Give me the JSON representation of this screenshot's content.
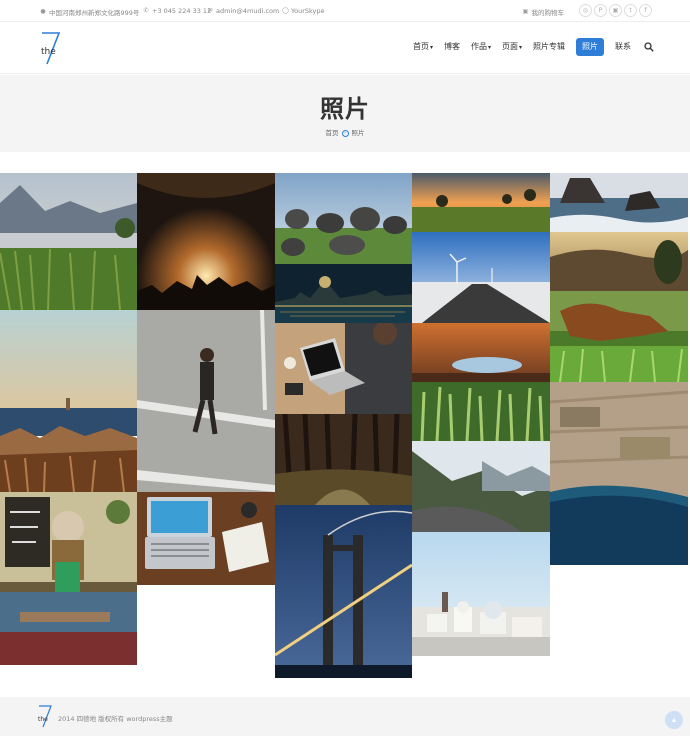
{
  "topbar": {
    "address": "中国河南郑州新郑文化路999号",
    "phone": "+3 045 224 33 12",
    "email": "admin@4mudi.com",
    "skype": "YourSkype",
    "cart": "我的购物车",
    "social_icons": [
      "dribbble-icon",
      "pinterest-icon",
      "instagram-icon",
      "twitter-icon",
      "facebook-icon"
    ]
  },
  "header": {
    "logo_text": "the",
    "nav": [
      {
        "label": "首页",
        "dropdown": true
      },
      {
        "label": "博客",
        "dropdown": false
      },
      {
        "label": "作品",
        "dropdown": true
      },
      {
        "label": "页面",
        "dropdown": true
      },
      {
        "label": "照片专辑",
        "dropdown": false
      },
      {
        "label": "照片",
        "dropdown": false,
        "active": true
      },
      {
        "label": "联系",
        "dropdown": false
      }
    ]
  },
  "title": {
    "heading": "照片",
    "breadcrumb_home": "首页",
    "breadcrumb_current": "照片"
  },
  "gallery": {
    "photos": [
      "lake-reeds",
      "concert-crowd",
      "stones-field",
      "sunset-trees",
      "coast-waves",
      "hills-tree",
      "city-night",
      "wind-turbine-road",
      "dog-grass",
      "sea-breakwater",
      "man-walking",
      "laptop-coffee",
      "sunset-puddle",
      "wheat-field",
      "aerial-coast",
      "forest-path",
      "mountain-road",
      "cafe-sign",
      "desk-laptop",
      "bridge-night",
      "white-village"
    ]
  },
  "footer": {
    "logo_text": "the",
    "copyright": "2014 四德地 版权所有 wordpress主题"
  },
  "colors": {
    "accent": "#2e7ed8",
    "band": "#f4f4f4"
  }
}
